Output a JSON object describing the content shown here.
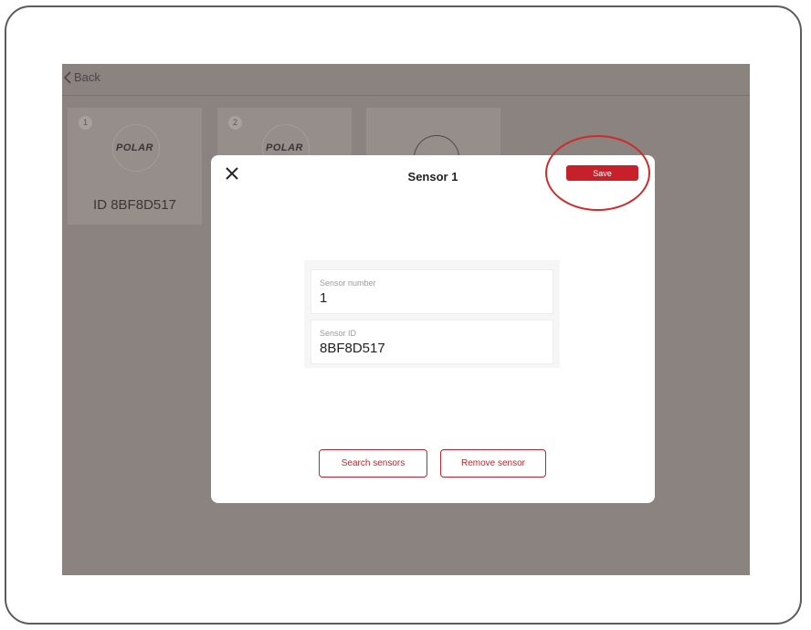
{
  "topbar": {
    "back_label": "Back"
  },
  "sensor_cards": [
    {
      "number": "1",
      "logo": "POLAR",
      "id_text": "ID 8BF8D517"
    },
    {
      "number": "2",
      "logo": "POLAR"
    }
  ],
  "modal": {
    "title": "Sensor 1",
    "save_label": "Save",
    "fields": {
      "sensor_number": {
        "label": "Sensor number",
        "value": "1"
      },
      "sensor_id": {
        "label": "Sensor ID",
        "value": "8BF8D517"
      }
    },
    "search_label": "Search sensors",
    "remove_label": "Remove sensor"
  },
  "colors": {
    "accent": "#c8202b",
    "overlay": "#8a8380",
    "highlight_ring": "#d12a2a"
  },
  "icons": [
    "chevron-left-icon",
    "close-icon",
    "sensor-ring-icon"
  ]
}
